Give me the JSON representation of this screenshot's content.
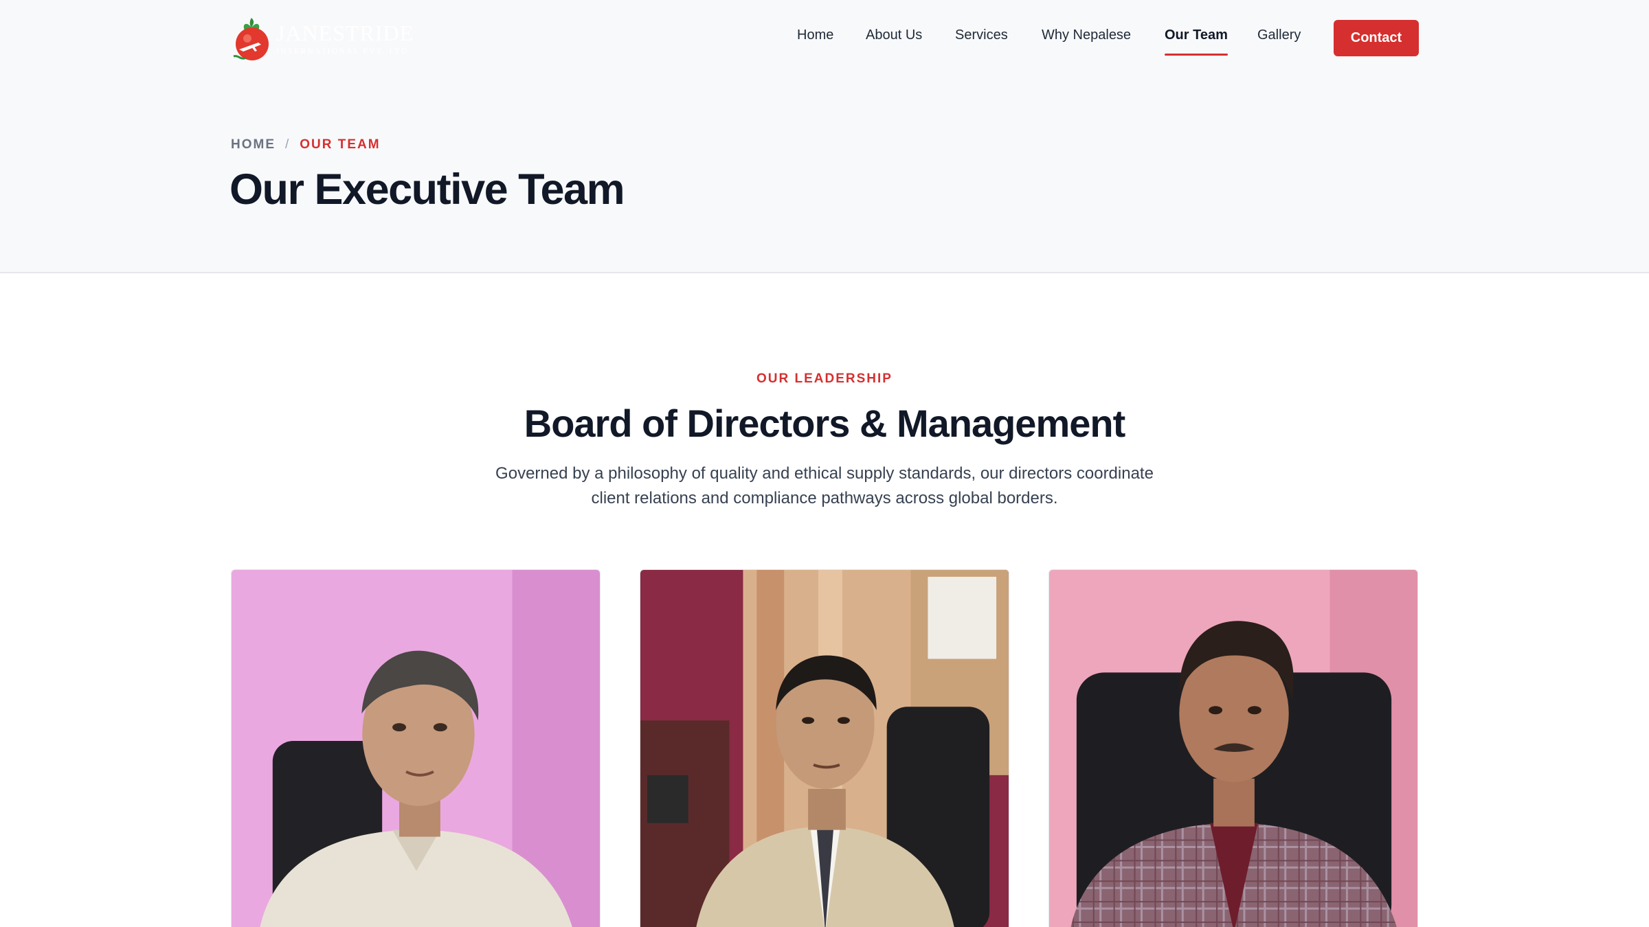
{
  "brand": {
    "name": "JANESTRIDE",
    "tagline": "INTERNATIONAL PVT. LTD",
    "accent": "#d62f2f"
  },
  "nav": {
    "items": [
      {
        "label": "Home"
      },
      {
        "label": "About Us"
      },
      {
        "label": "Services"
      },
      {
        "label": "Why Nepalese"
      },
      {
        "label": "Our Team",
        "active": true
      },
      {
        "label": "Gallery"
      }
    ],
    "contact_label": "Contact"
  },
  "breadcrumb": {
    "home": "HOME",
    "separator": "/",
    "current": "OUR TEAM"
  },
  "page_title": "Our Executive Team",
  "section": {
    "eyebrow": "OUR LEADERSHIP",
    "title": "Board of Directors & Management",
    "description": "Governed by a philosophy of quality and ethical supply standards, our directors coordinate client relations and compliance pathways across global borders."
  },
  "team": [
    {
      "photo": "director-portrait-1",
      "background": "#e9a6dc"
    },
    {
      "photo": "director-portrait-2",
      "background": "#8c2a45"
    },
    {
      "photo": "director-portrait-3",
      "background": "#eaa1b8"
    }
  ]
}
